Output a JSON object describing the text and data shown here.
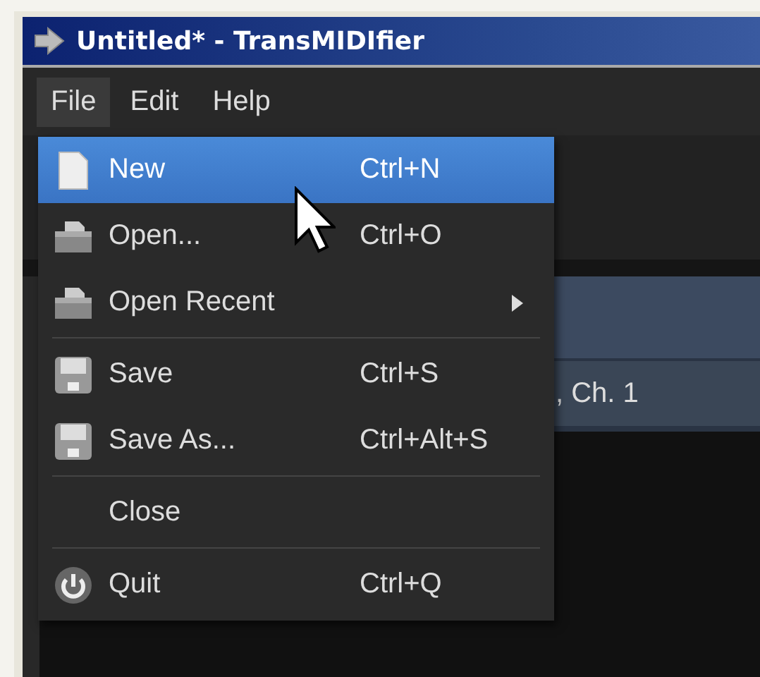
{
  "window": {
    "title": "Untitled* - TransMIDIfier"
  },
  "menubar": [
    {
      "label": "File",
      "selected": true
    },
    {
      "label": "Edit",
      "selected": false
    },
    {
      "label": "Help",
      "selected": false
    }
  ],
  "file_menu": [
    {
      "kind": "document",
      "label": "New",
      "shortcut": "Ctrl+N",
      "selected": true,
      "submenu": false
    },
    {
      "kind": "folder",
      "label": "Open...",
      "shortcut": "Ctrl+O",
      "selected": false,
      "submenu": false
    },
    {
      "kind": "folder",
      "label": "Open Recent",
      "selected": false,
      "submenu": true
    },
    {
      "kind": "separator"
    },
    {
      "kind": "disk",
      "label": "Save",
      "shortcut": "Ctrl+S",
      "selected": false,
      "submenu": false
    },
    {
      "kind": "disk",
      "label": "Save As...",
      "shortcut": "Ctrl+Alt+S",
      "selected": false,
      "submenu": false
    },
    {
      "kind": "separator"
    },
    {
      "kind": "plain",
      "label": "Close",
      "selected": false,
      "submenu": false
    },
    {
      "kind": "separator"
    },
    {
      "kind": "power",
      "label": "Quit",
      "shortcut": "Ctrl+Q",
      "selected": false,
      "submenu": false
    }
  ],
  "background": {
    "track_label": ", Ch. 1"
  }
}
